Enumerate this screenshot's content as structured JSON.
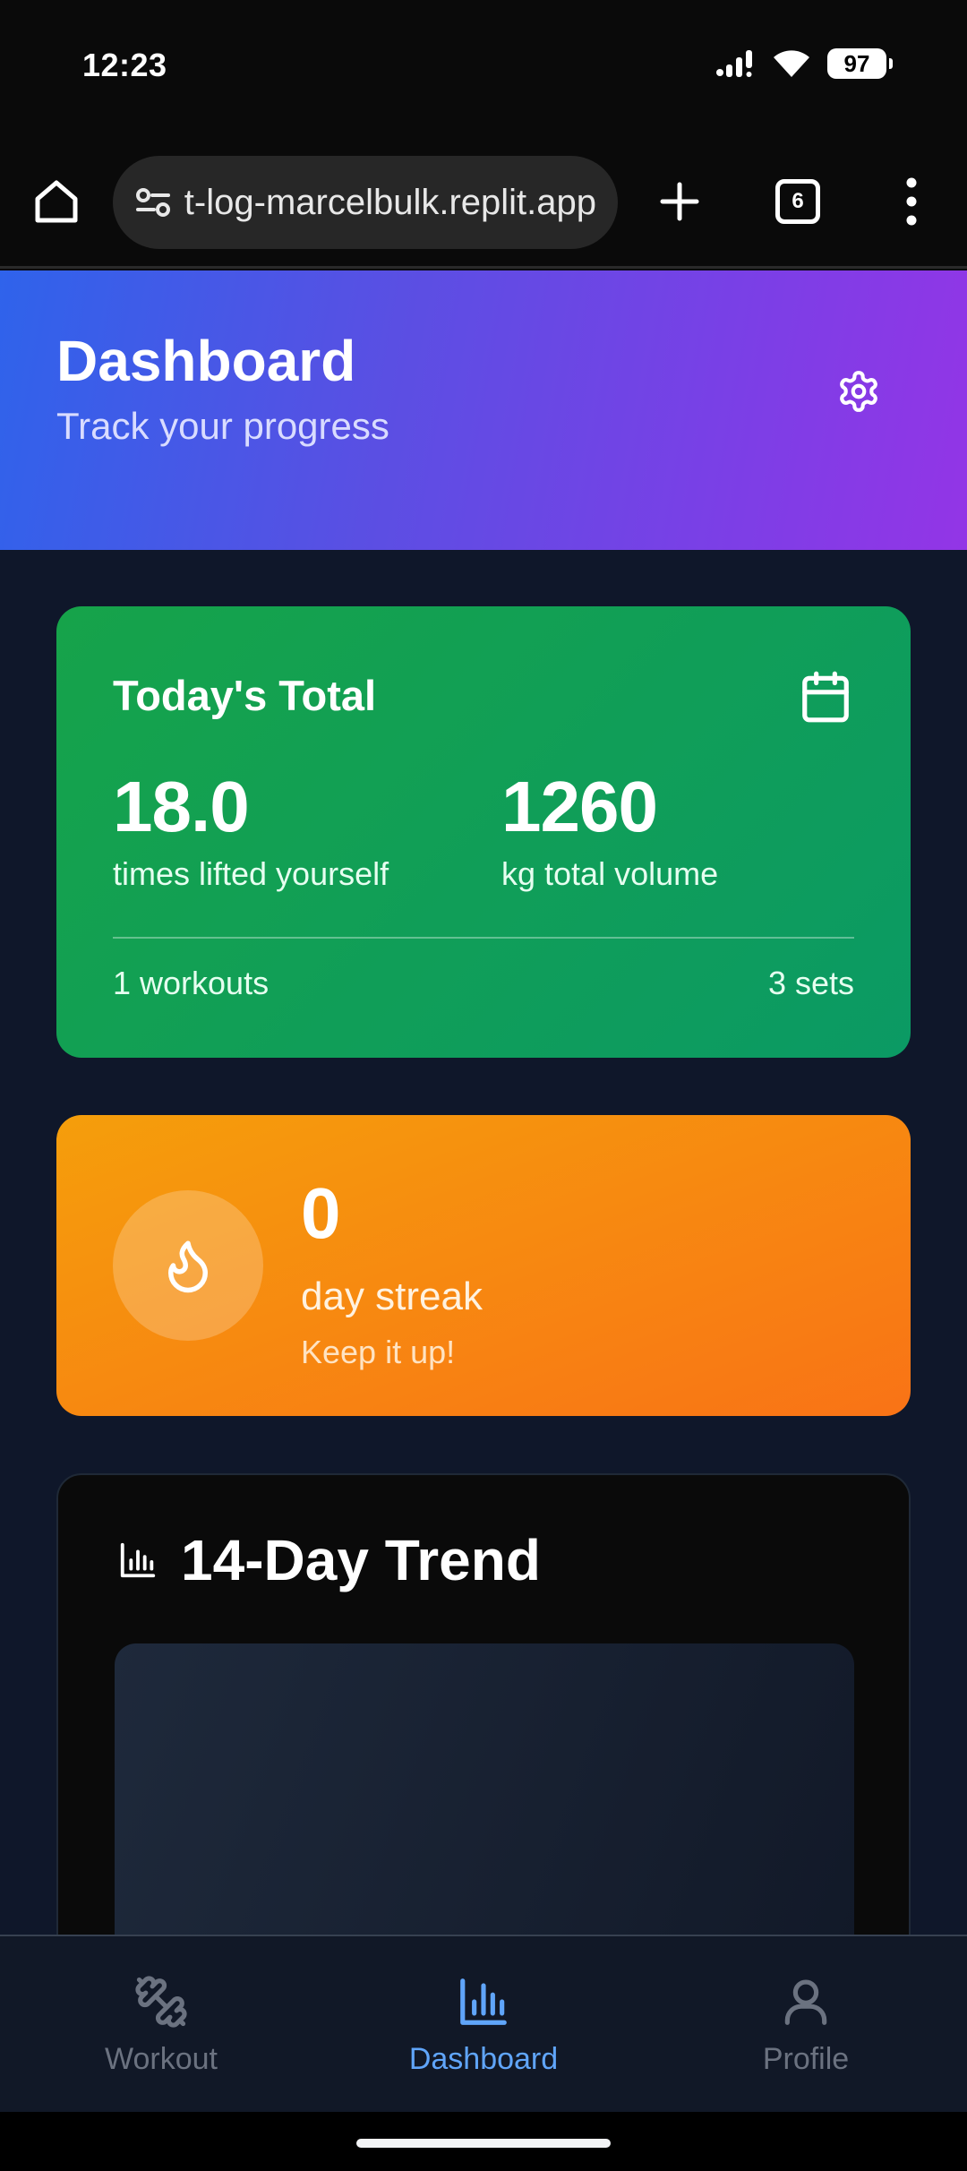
{
  "status_bar": {
    "time": "12:23",
    "battery": "97"
  },
  "browser": {
    "url": "workout-log-marcelbulk.replit.app",
    "tab_count": "6"
  },
  "header": {
    "title": "Dashboard",
    "subtitle": "Track your progress"
  },
  "today_total": {
    "title": "Today's Total",
    "lifted_value": "18.0",
    "lifted_label": "times lifted yourself",
    "volume_value": "1260",
    "volume_label": "kg total volume",
    "workouts": "1 workouts",
    "sets": "3 sets"
  },
  "streak": {
    "value": "0",
    "label": "day streak",
    "sub": "Keep it up!"
  },
  "trend": {
    "title": "14-Day Trend"
  },
  "nav": {
    "items": [
      {
        "label": "Workout",
        "icon": "dumbbell-icon",
        "active": false
      },
      {
        "label": "Dashboard",
        "icon": "bar-chart-icon",
        "active": true
      },
      {
        "label": "Profile",
        "icon": "user-icon",
        "active": false
      }
    ]
  },
  "colors": {
    "header_gradient_start": "#2f63eb",
    "header_gradient_end": "#9335e6",
    "total_card": "#16a34a",
    "streak_card": "#f97316",
    "nav_active": "#60a5fa",
    "nav_inactive": "#6b7280",
    "background": "#0f172a"
  }
}
